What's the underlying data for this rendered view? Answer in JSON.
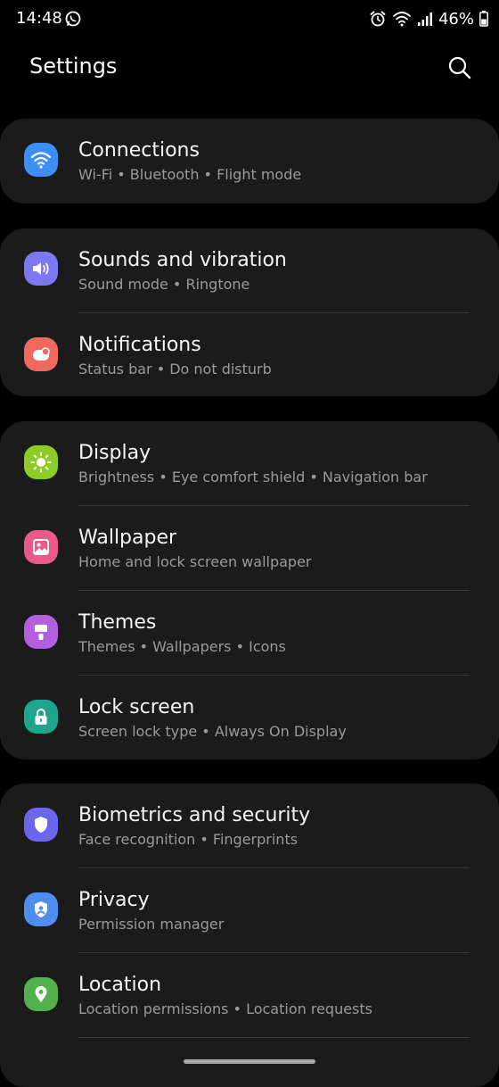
{
  "status_bar": {
    "time": "14:48",
    "battery": "46%",
    "icons": [
      "whatsapp-icon",
      "alarm-icon",
      "wifi-icon",
      "signal-icon",
      "battery-icon"
    ]
  },
  "header": {
    "title": "Settings",
    "search_icon": "search-icon"
  },
  "colors": {
    "background": "#000000",
    "card": "#1b1b1b",
    "subtitle": "#9a9a9a",
    "divider": "#3a3a3a"
  },
  "groups": [
    {
      "items": [
        {
          "title": "Connections",
          "subtitle": "Wi-Fi  •  Bluetooth  •  Flight mode",
          "icon": "wifi-icon",
          "color": "#3d8ef5"
        }
      ]
    },
    {
      "items": [
        {
          "title": "Sounds and vibration",
          "subtitle": "Sound mode  •  Ringtone",
          "icon": "speaker-icon",
          "color": "#7b78f0"
        },
        {
          "title": "Notifications",
          "subtitle": "Status bar  •  Do not disturb",
          "icon": "notification-icon",
          "color": "#ef6a5c"
        }
      ]
    },
    {
      "items": [
        {
          "title": "Display",
          "subtitle": "Brightness  •  Eye comfort shield  •  Navigation bar",
          "icon": "sun-icon",
          "color": "#8ccc25"
        },
        {
          "title": "Wallpaper",
          "subtitle": "Home and lock screen wallpaper",
          "icon": "image-icon",
          "color": "#ea5a88"
        },
        {
          "title": "Themes",
          "subtitle": "Themes  •  Wallpapers  •  Icons",
          "icon": "brush-icon",
          "color": "#b25fe0"
        },
        {
          "title": "Lock screen",
          "subtitle": "Screen lock type  •  Always On Display",
          "icon": "lock-icon",
          "color": "#1fa58e"
        }
      ]
    },
    {
      "items": [
        {
          "title": "Biometrics and security",
          "subtitle": "Face recognition  •  Fingerprints",
          "icon": "shield-icon",
          "color": "#6b66ee"
        },
        {
          "title": "Privacy",
          "subtitle": "Permission manager",
          "icon": "privacy-icon",
          "color": "#4f8ef0"
        },
        {
          "title": "Location",
          "subtitle": "Location permissions  •  Location requests",
          "icon": "location-pin-icon",
          "color": "#52b14d"
        }
      ]
    }
  ]
}
